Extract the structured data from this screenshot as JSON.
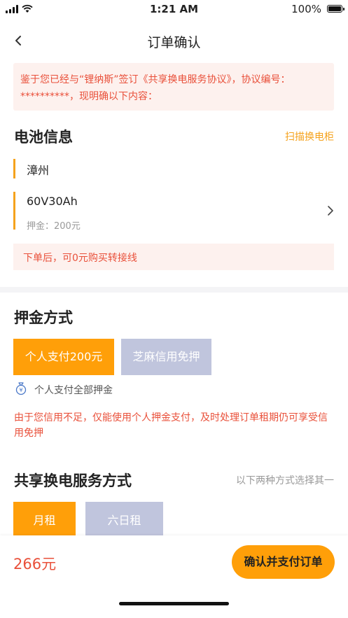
{
  "status_bar": {
    "time": "1:21 AM",
    "battery": "100%"
  },
  "nav": {
    "title": "订单确认"
  },
  "notice": {
    "text": "鉴于您已经与“锂纳斯”签订《共享换电服务协议》，协议编号：**********，现明确以下内容："
  },
  "battery_info": {
    "title": "电池信息",
    "scan_link": "扫描换电柜",
    "city": "漳州",
    "model": "60V30Ah",
    "deposit": "押金：200元",
    "tip": "下单后，可0元购买转接线"
  },
  "deposit_method": {
    "title": "押金方式",
    "options": [
      "个人支付200元",
      "芝麻信用免押"
    ],
    "selected_desc": "个人支付全部押金",
    "warning": "由于您信用不足，仅能使用个人押金支付，及时处理订单租期仍可享受信用免押"
  },
  "service_method": {
    "title": "共享换电服务方式",
    "hint": "以下两种方式选择其一",
    "options": [
      "月租",
      "六日租"
    ]
  },
  "footer": {
    "price": "266元",
    "pay_button": "确认并支付订单"
  },
  "colors": {
    "accent": "#ff9f09",
    "warning": "#e9503a",
    "link": "#f5a21c",
    "disabled": "#c0c5dd"
  }
}
